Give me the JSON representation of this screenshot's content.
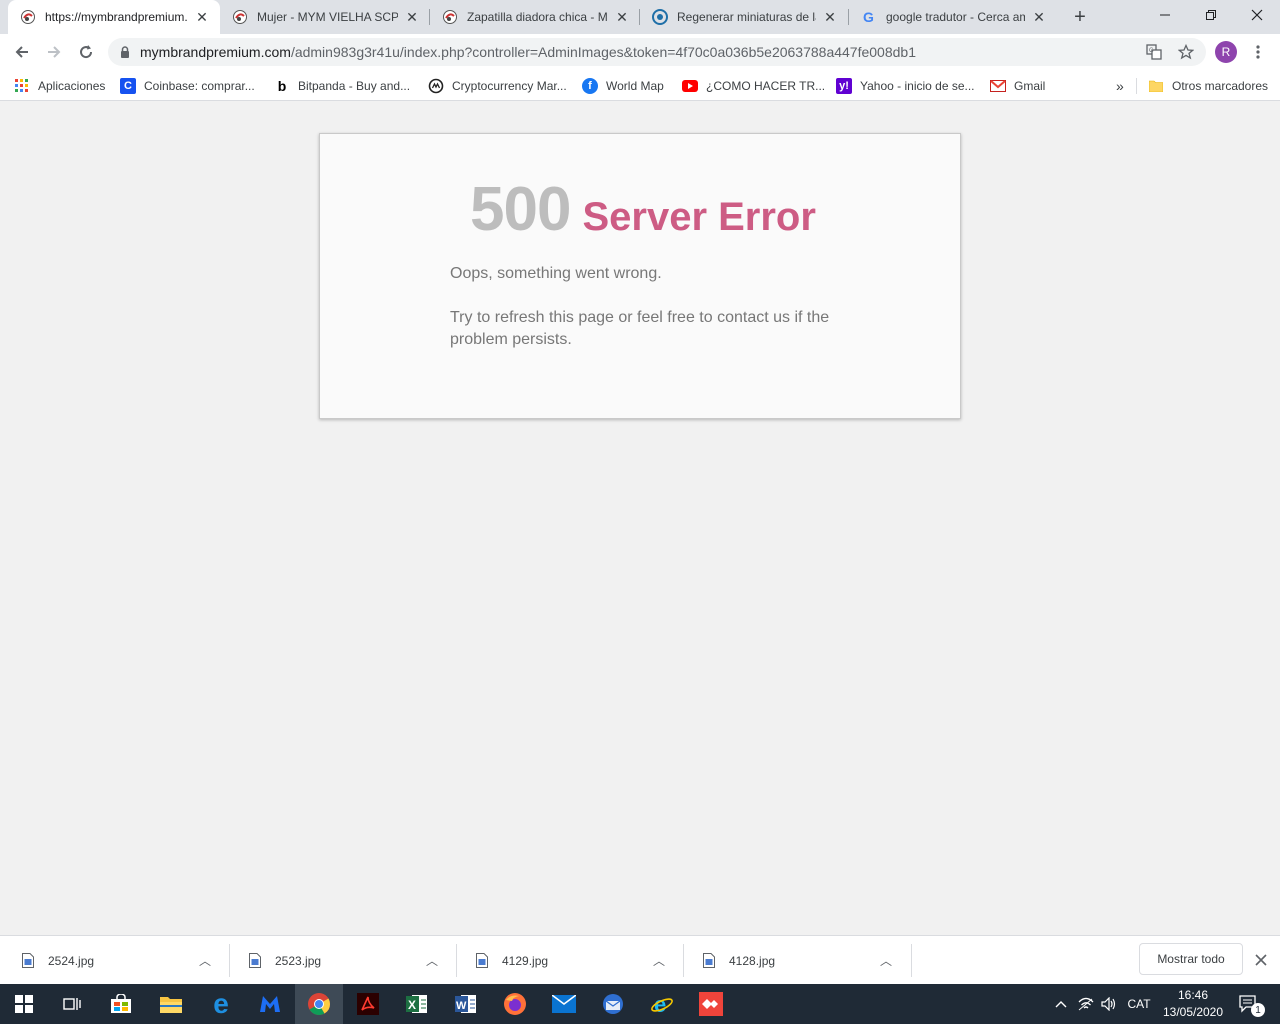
{
  "tabs": [
    {
      "title": "https://mymbrandpremium.com/",
      "active": true
    },
    {
      "title": "Mujer - MYM VIELHA SCP",
      "active": false
    },
    {
      "title": "Zapatilla diadora chica - MYM",
      "active": false
    },
    {
      "title": "Regenerar miniaturas de las",
      "active": false
    },
    {
      "title": "google tradutor - Cerca amb",
      "active": false
    }
  ],
  "new_tab_label": "+",
  "omnibox": {
    "host": "mymbrandpremium.com",
    "path": "/admin983g3r41u/index.php?controller=AdminImages&token=4f70c0a036b5e2063788a447fe008db1"
  },
  "profile_initial": "R",
  "bookmarks": [
    {
      "label": "Aplicaciones",
      "icon": "apps-grid-icon"
    },
    {
      "label": "Coinbase: comprar...",
      "icon": "coinbase-icon"
    },
    {
      "label": "Bitpanda - Buy and...",
      "icon": "bitpanda-icon"
    },
    {
      "label": "Cryptocurrency Mar...",
      "icon": "coinmarketcap-icon"
    },
    {
      "label": "World Map",
      "icon": "facebook-icon"
    },
    {
      "label": "¿COMO HACER TR...",
      "icon": "youtube-icon"
    },
    {
      "label": "Yahoo - inicio de se...",
      "icon": "yahoo-icon"
    },
    {
      "label": "Gmail",
      "icon": "gmail-icon"
    }
  ],
  "bookmarks_overflow": "»",
  "other_bookmarks": "Otros marcadores",
  "error": {
    "code": "500",
    "title": "Server Error",
    "message": "Oops, something went wrong.",
    "detail": "Try to refresh this page or feel free to contact us if the problem persists."
  },
  "downloads": [
    {
      "filename": "2524.jpg"
    },
    {
      "filename": "2523.jpg"
    },
    {
      "filename": "4129.jpg"
    },
    {
      "filename": "4128.jpg"
    }
  ],
  "show_all_label": "Mostrar todo",
  "taskbar": {
    "language": "CAT",
    "time": "16:46",
    "date": "13/05/2020",
    "notification_count": "1"
  },
  "colors": {
    "error_code": "#bdbdbd",
    "error_title": "#cd5c84",
    "taskbar": "#1f2a36"
  }
}
